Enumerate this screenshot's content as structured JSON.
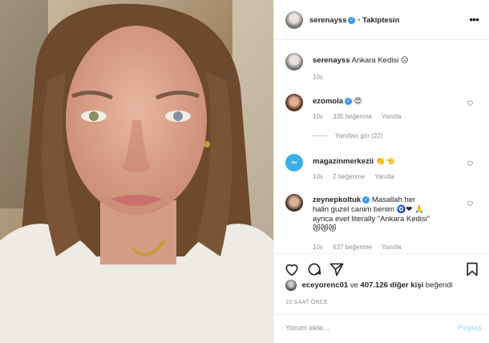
{
  "post": {
    "author": "serenayss",
    "follow_status": "Takiptesin",
    "caption": "Ankara Kedisi",
    "caption_emoji": "😑",
    "caption_time": "10s",
    "likers_lead": "eceyorenc01",
    "likes_joiner": "ve",
    "likes_count": "407.126 diğer kişi",
    "likes_suffix": "beğendi",
    "posted_time": "10 SAAT ÖNCE",
    "comment_placeholder": "Yorum ekle...",
    "post_button": "Paylaş"
  },
  "comments": [
    {
      "user": "ezomola",
      "text": "😍",
      "time": "10s",
      "likes": "335 beğenme",
      "reply": "Yanıtla",
      "view_replies": "Yanıtları gör (22)"
    },
    {
      "user": "magazinmerkezii",
      "text": "👏👈",
      "time": "10s",
      "likes": "2 beğenme",
      "reply": "Yanıtla"
    },
    {
      "user": "zeynepkoltuk",
      "text": "Masallah her halin guzel canim benim 🧿❤ 🙏 ayrica evet literally \"Ankara Kedisi\" 😻😻😻",
      "time": "10s",
      "likes": "637 beğenme",
      "reply": "Yanıtla"
    }
  ],
  "icons": [
    "heart-icon",
    "comment-icon",
    "share-icon",
    "bookmark-icon",
    "more-icon",
    "verified-icon"
  ],
  "colors": {
    "verified": "#3897f0",
    "muted": "#8e8e8e",
    "post_disabled": "#b2dffc"
  }
}
